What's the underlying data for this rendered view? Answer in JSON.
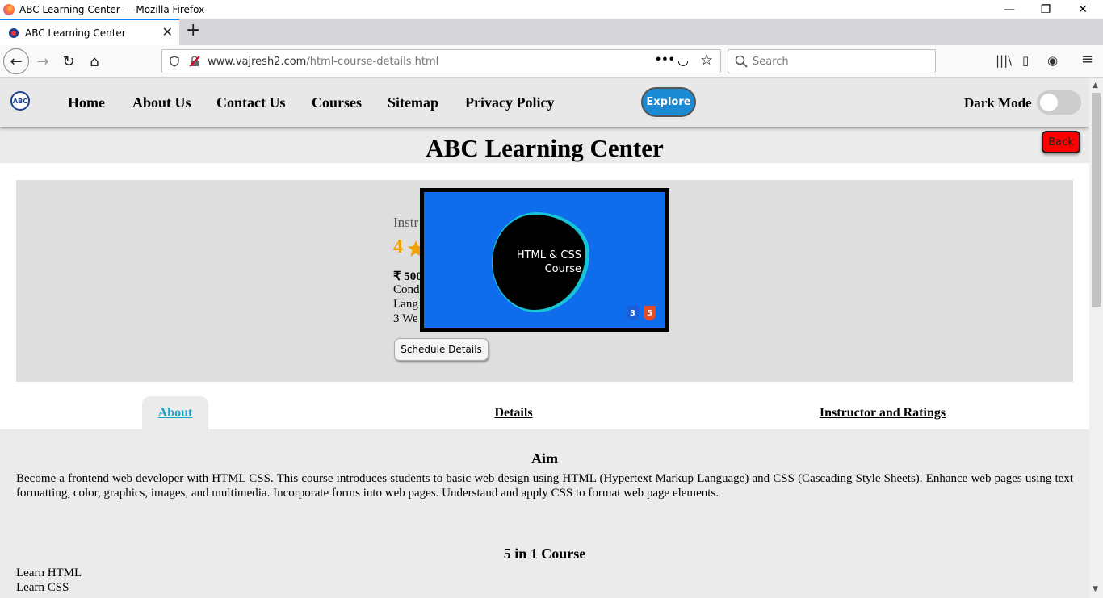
{
  "window": {
    "title": "ABC Learning Center — Mozilla Firefox",
    "controls": {
      "minimize": "—",
      "restore": "❐",
      "close": "✕"
    }
  },
  "browser": {
    "tab": {
      "title": "ABC Learning Center",
      "close": "✕"
    },
    "new_tab": "+",
    "nav": {
      "back": "←",
      "forward": "→",
      "reload": "↻",
      "home": "⌂"
    },
    "url": {
      "host": "www.vajresh2.com",
      "path": "/html-course-details.html"
    },
    "url_actions": {
      "more": "•••",
      "pocket": "◡",
      "bookmark": "☆"
    },
    "search_placeholder": "Search",
    "toolbar_icons": {
      "library": "|||\\",
      "sidebar": "▯",
      "account": "◉",
      "menu": "≡"
    }
  },
  "site": {
    "logo_text": "ABC",
    "nav": [
      "Home",
      "About Us",
      "Contact Us",
      "Courses",
      "Sitemap",
      "Privacy Policy"
    ],
    "explore_label": "Explore",
    "dark_mode_label": "Dark Mode",
    "dark_mode_on": false,
    "page_title": "ABC Learning Center",
    "back_label": "Back"
  },
  "course": {
    "instructor_fragment": "Instr",
    "rating_fragment": "4",
    "price_fragment": "₹ 500",
    "info_fragments": [
      "Cond",
      "Lang",
      "3 We"
    ],
    "schedule_label": "Schedule Details",
    "thumbnail": {
      "line1": "HTML & CSS",
      "line2": "Course",
      "badge_css": "3",
      "badge_html": "5"
    }
  },
  "tabs": [
    {
      "label": "About",
      "active": true
    },
    {
      "label": "Details",
      "active": false
    },
    {
      "label": "Instructor and Ratings",
      "active": false
    }
  ],
  "about": {
    "aim_heading": "Aim",
    "aim_text": "Become a frontend web developer with HTML CSS. This course introduces students to basic web design using HTML (Hypertext Markup Language) and CSS (Cascading Style Sheets). Enhance web pages using text formatting, color, graphics, images, and multimedia. Incorporate forms into web pages. Understand and apply CSS to format web page elements.",
    "five_in_one_heading": "5 in 1 Course",
    "learn_items": [
      "Learn HTML",
      "Learn CSS"
    ]
  },
  "colors": {
    "accent": "#1a8ad4",
    "back_button": "#ff0000",
    "active_tab": "#1aa6c8",
    "rating": "#f0a000"
  }
}
